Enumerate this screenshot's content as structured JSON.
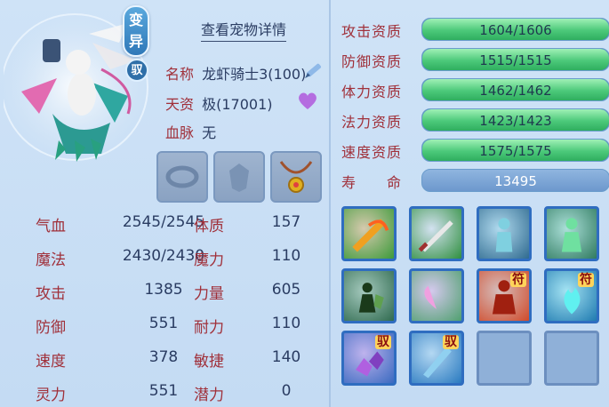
{
  "header": {
    "badge_line1": "变",
    "badge_line2": "异",
    "badge_small": "驭",
    "detail_link": "查看宠物详情"
  },
  "info": {
    "name_label": "名称",
    "name_value": "龙虾骑士3(100)",
    "talent_label": "天资",
    "talent_value": "极(17001)",
    "blood_label": "血脉",
    "blood_value": "无"
  },
  "stats": {
    "hp_label": "气血",
    "hp_value": "2545/2545",
    "mp_label": "魔法",
    "mp_value": "2430/2430",
    "atk_label": "攻击",
    "atk_value": "1385",
    "def_label": "防御",
    "def_value": "551",
    "spd_label": "速度",
    "spd_value": "378",
    "spi_label": "灵力",
    "spi_value": "551",
    "con_label": "体质",
    "con_value": "157",
    "mag_label": "魔力",
    "mag_value": "110",
    "str_label": "力量",
    "str_value": "605",
    "end_label": "耐力",
    "end_value": "110",
    "agi_label": "敏捷",
    "agi_value": "140",
    "pot_label": "潜力",
    "pot_value": "0"
  },
  "aptitudes": [
    {
      "label": "攻击资质",
      "value": "1604/1606",
      "fill": 0.998
    },
    {
      "label": "防御资质",
      "value": "1515/1515",
      "fill": 1
    },
    {
      "label": "体力资质",
      "value": "1462/1462",
      "fill": 1
    },
    {
      "label": "法力资质",
      "value": "1423/1423",
      "fill": 1
    },
    {
      "label": "速度资质",
      "value": "1575/1575",
      "fill": 1
    }
  ],
  "life": {
    "label": "寿　　命",
    "value": "13495"
  },
  "skills": [
    {
      "name": "flame-sword-skill",
      "tag": ""
    },
    {
      "name": "sword-slash-skill",
      "tag": ""
    },
    {
      "name": "shadow-figure-skill",
      "tag": ""
    },
    {
      "name": "green-figure-skill",
      "tag": ""
    },
    {
      "name": "defense-warrior-skill",
      "tag": ""
    },
    {
      "name": "heart-skill",
      "tag": ""
    },
    {
      "name": "red-warrior-skill",
      "tag": "符"
    },
    {
      "name": "blue-flame-skill",
      "tag": "符"
    },
    {
      "name": "purple-crystal-skill",
      "tag": "驭"
    },
    {
      "name": "ice-sword-skill",
      "tag": "驭"
    }
  ],
  "colors": {
    "label_red": "#a0303a",
    "bar_green": "#4cc97a",
    "bar_blue": "#4a80bf"
  }
}
